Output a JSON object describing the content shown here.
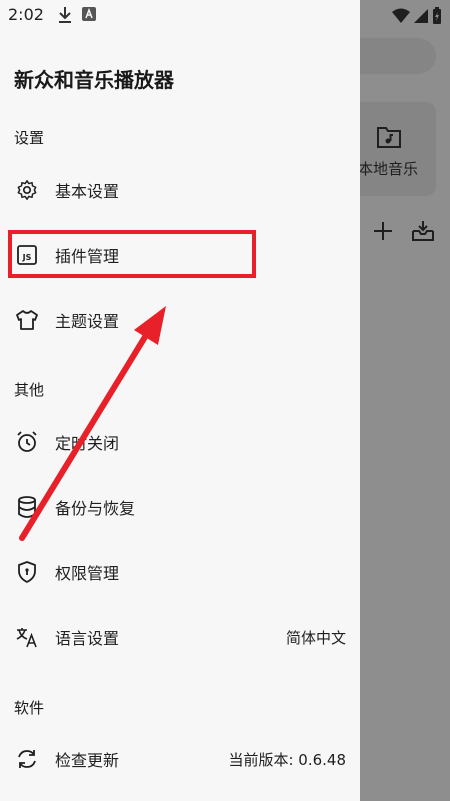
{
  "status_bar": {
    "time": "2:02"
  },
  "drawer": {
    "title": "新众和音乐播放器",
    "sections": [
      {
        "label": "设置"
      },
      {
        "label": "其他"
      },
      {
        "label": "软件"
      }
    ],
    "items": [
      {
        "label": "基本设置",
        "icon": "gear-icon"
      },
      {
        "label": "插件管理",
        "icon": "js-plugin-icon"
      },
      {
        "label": "主题设置",
        "icon": "tshirt-icon"
      },
      {
        "label": "定时关闭",
        "icon": "alarm-clock-icon"
      },
      {
        "label": "备份与恢复",
        "icon": "database-icon"
      },
      {
        "label": "权限管理",
        "icon": "shield-icon"
      },
      {
        "label": "语言设置",
        "icon": "translate-icon",
        "value": "简体中文"
      },
      {
        "label": "检查更新",
        "icon": "refresh-icon",
        "value": "当前版本: 0.6.48"
      }
    ]
  },
  "background": {
    "card_label": "本地音乐"
  },
  "colors": {
    "drawer_bg": "#f7f7f7",
    "scrim": "#8e8e8e",
    "annotation": "#e8202a"
  }
}
